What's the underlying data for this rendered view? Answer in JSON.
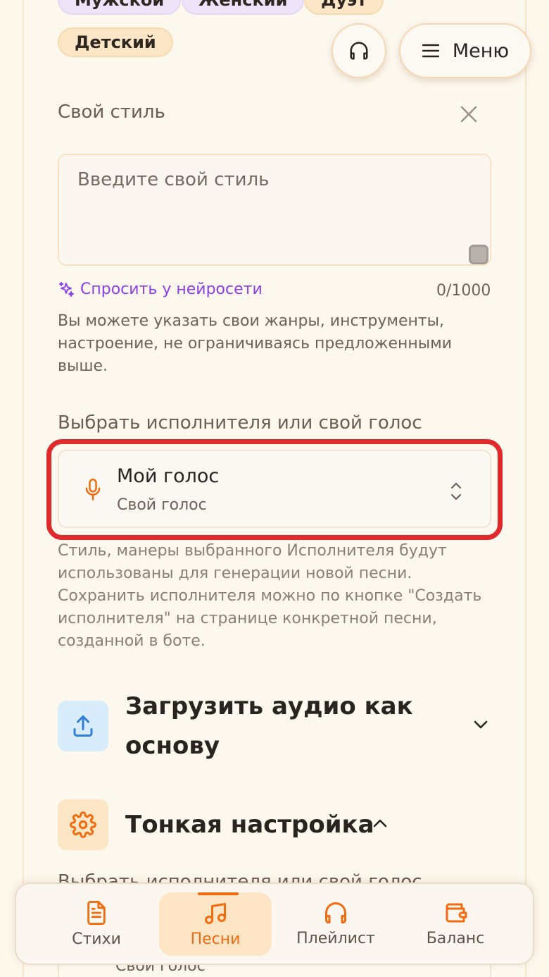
{
  "style_chips": {
    "male": "Мужской",
    "female": "Женский",
    "duet": "Дуэт",
    "kids": "Детский"
  },
  "header": {
    "menu_label": "Меню"
  },
  "own_style": {
    "label": "Свой стиль",
    "placeholder": "Введите свой стиль",
    "ask_ai": "Спросить у нейросети",
    "counter": "0/1000",
    "hint": "Вы можете указать свои жанры, инструменты, настроение, не ограничиваясь предложенными выше."
  },
  "artist": {
    "label": "Выбрать исполнителя или свой голос",
    "selected_title": "Мой голос",
    "selected_sub": "Свой голос",
    "hint": "Стиль, манеры выбранного Исполнителя будут использованы для генерации новой песни. Сохранить исполнителя можно по кнопке \"Создать исполнителя\" на странице конкретной песни, созданной в боте."
  },
  "sections": {
    "upload_title": "Загрузить аудио как основу",
    "fine_tune_title": "Тонкая настройка",
    "fine_tune_artist_label": "Выбрать исполнителя или свой голос",
    "fine_tune_artist_sub": "Свой голос"
  },
  "bottom_nav": {
    "lyrics": "Стихи",
    "songs": "Песни",
    "playlist": "Плейлист",
    "balance": "Баланс"
  },
  "colors": {
    "accent": "#f26b0f",
    "ai_purple": "#8b3ee6",
    "highlight_red": "#e0292b",
    "upload_blue": "#2f7fd8"
  }
}
